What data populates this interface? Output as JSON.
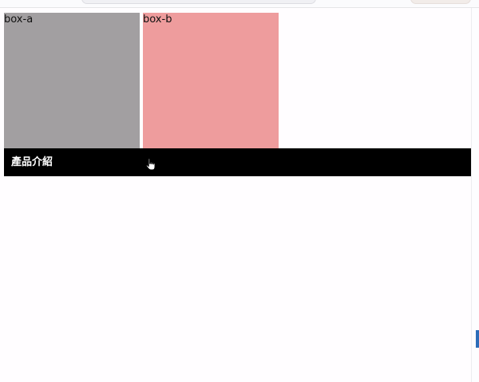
{
  "boxes": {
    "a": {
      "label": "box-a",
      "color": "#a29fa1"
    },
    "b": {
      "label": "box-b",
      "color": "#ee9c9d"
    }
  },
  "nav": {
    "label": "產品介紹",
    "background": "#000000"
  },
  "cursor": {
    "icon": "hand-pointer-icon"
  }
}
